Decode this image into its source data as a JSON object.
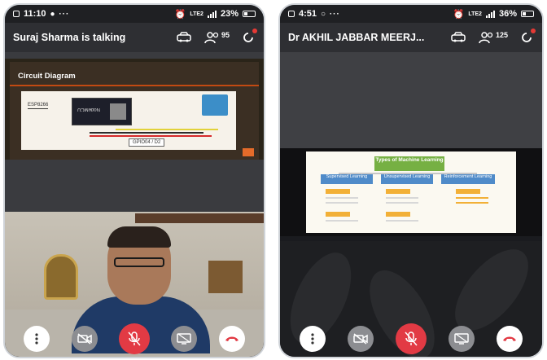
{
  "colors": {
    "background": "#2b2c2f",
    "header_bg": "#2e2f33",
    "mic_button": "#e23a44",
    "end_call_button": "#e23a44",
    "slide_accent": "#c24a12",
    "ml_title_green": "#76b043"
  },
  "left_phone": {
    "status": {
      "time": "11:10",
      "dots": "● ···",
      "battery": "23%",
      "network": "LTE2"
    },
    "header": {
      "title": "Suraj Sharma is talking",
      "participant_count": "95",
      "icons": [
        "car-icon",
        "people-icon",
        "refresh-icon"
      ]
    },
    "slide": {
      "title": "Circuit Diagram",
      "esp_label": "ESP8266",
      "board_text": "NodeMCU",
      "gpio_label": "GPIO04 / D2"
    }
  },
  "right_phone": {
    "status": {
      "time": "4:51",
      "dots": "○ ···",
      "battery": "36%",
      "network": "LTE2"
    },
    "header": {
      "title": "Dr AKHIL JABBAR MEERJ...",
      "participant_count": "125",
      "icons": [
        "car-icon",
        "people-icon",
        "refresh-icon"
      ]
    },
    "slide": {
      "title": "Types of Machine Learning",
      "boxes": [
        "Supervised Learning",
        "Unsupervised Learning",
        "Reinforcement Learning"
      ]
    }
  },
  "controls": [
    {
      "name": "more-options-button",
      "icon": "more-vertical-icon"
    },
    {
      "name": "camera-off-button",
      "icon": "video-off-icon"
    },
    {
      "name": "mute-button",
      "icon": "mic-off-icon"
    },
    {
      "name": "share-screen-button",
      "icon": "screen-share-off-icon"
    },
    {
      "name": "end-call-button",
      "icon": "phone-hangup-icon"
    }
  ]
}
